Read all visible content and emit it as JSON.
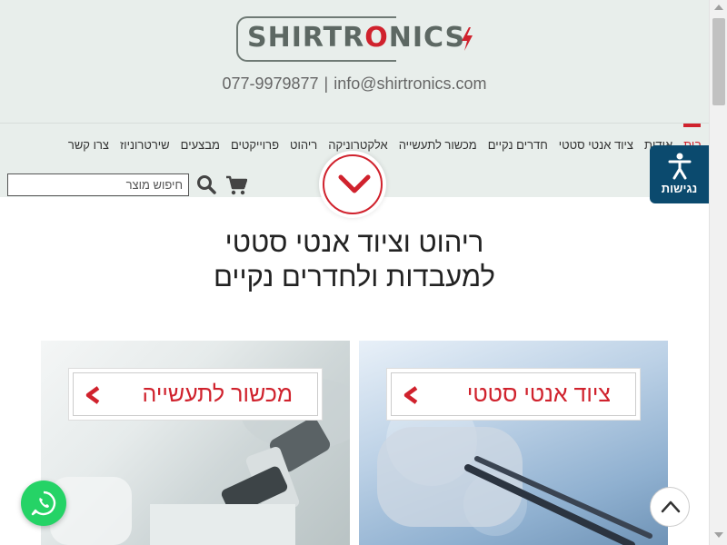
{
  "brand": {
    "logo_main": "SHIRTR",
    "logo_highlight": "O",
    "logo_rest": "NICS",
    "accent_color": "#d0222d",
    "logo_color": "#5d6863"
  },
  "contact": {
    "phone": "077-9979877",
    "separator": "|",
    "email": "info@shirtronics.com"
  },
  "nav": {
    "items": [
      {
        "label": "בית"
      },
      {
        "label": "אודות"
      },
      {
        "label": "ציוד אנטי סטטי"
      },
      {
        "label": "חדרים נקיים"
      },
      {
        "label": "מכשור לתעשייה"
      },
      {
        "label": "אלקטרוניקה"
      },
      {
        "label": "ריהוט"
      },
      {
        "label": "פרוייקטים"
      },
      {
        "label": "מבצעים"
      },
      {
        "label": "שירטרוניוז"
      },
      {
        "label": "צרו קשר"
      }
    ],
    "search_placeholder": "חיפוש מוצר",
    "search_icon": "search-icon",
    "cart_icon": "cart-icon",
    "expand_icon": "chevron-down-icon"
  },
  "accessibility": {
    "label": "נגישות",
    "icon": "accessibility-icon",
    "bg_color": "#0b4a6e"
  },
  "headline": {
    "line1": "ריהוט וציוד אנטי סטטי",
    "line2": "למעבדות ולחדרים נקיים"
  },
  "cards": {
    "right": {
      "label": "ציוד אנטי סטטי",
      "icon": "chevron-left-icon"
    },
    "left": {
      "label": "מכשור לתעשייה",
      "icon": "chevron-left-icon"
    }
  },
  "floating": {
    "whatsapp_icon": "whatsapp-icon",
    "scroll_top_icon": "chevron-up-icon"
  }
}
